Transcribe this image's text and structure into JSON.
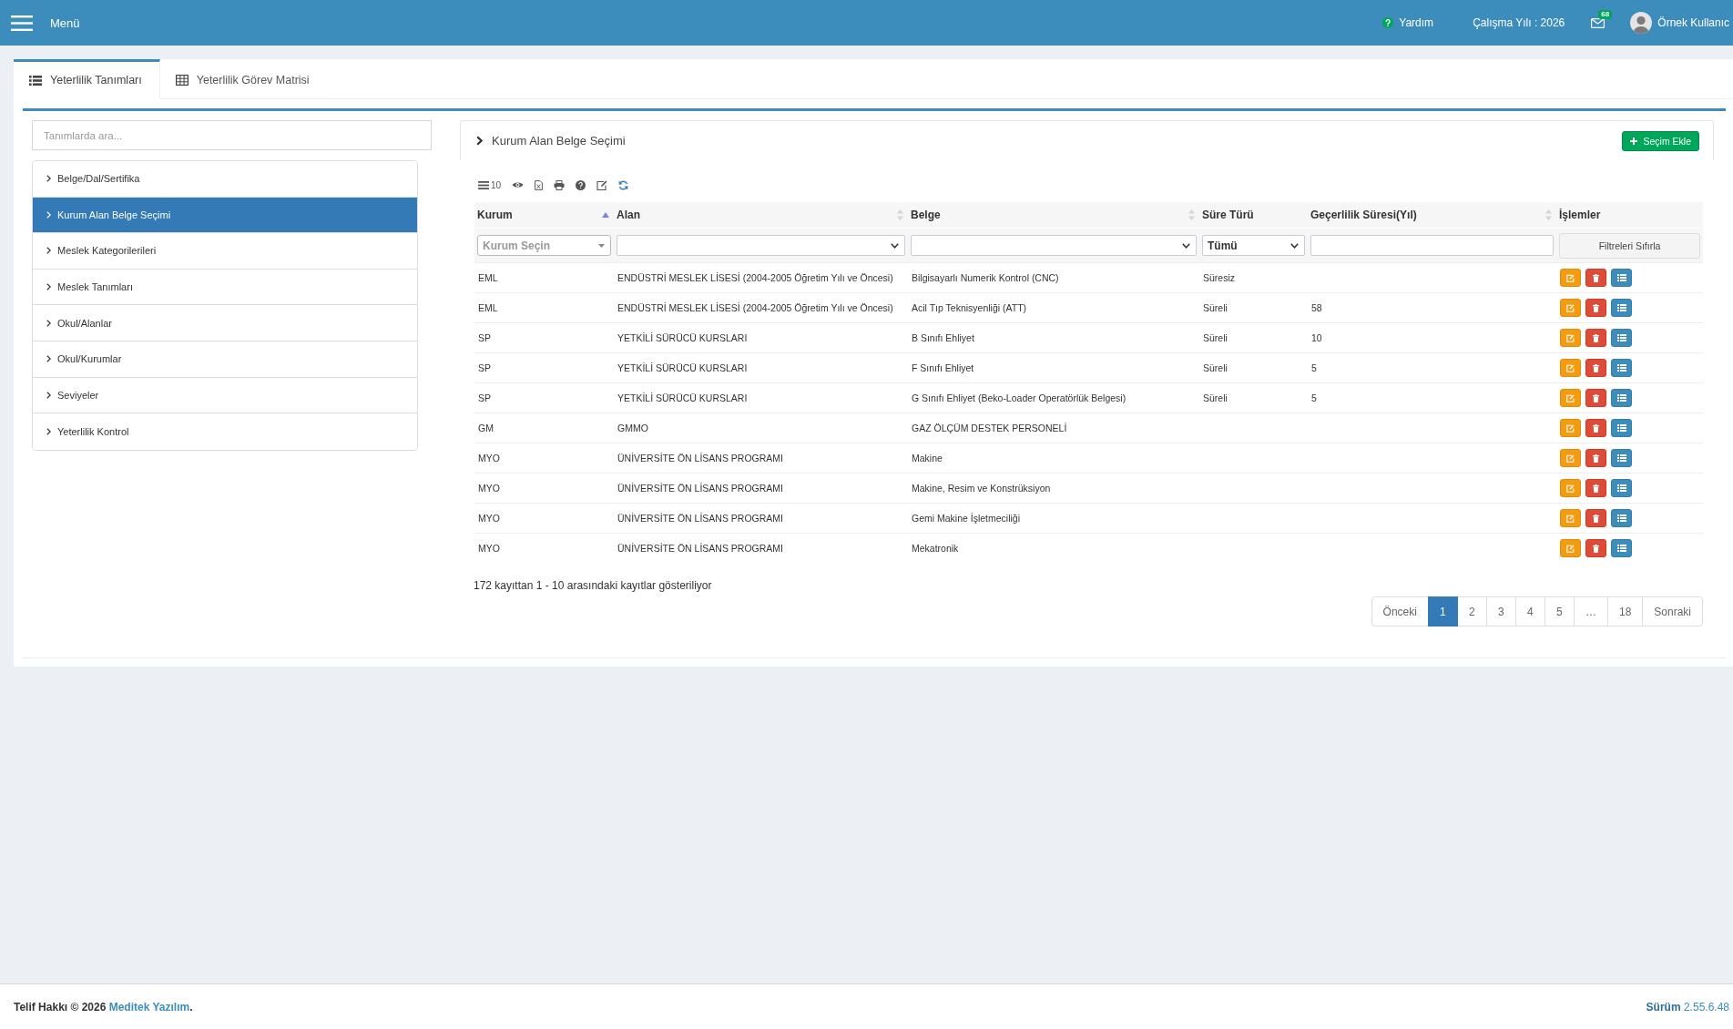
{
  "topbar": {
    "menu": "Menü",
    "help": "Yardım",
    "work_year": "Çalışma Yılı : 2026",
    "mail_count": "68",
    "user": "Örnek Kullanıc"
  },
  "tabs": [
    {
      "label": "Yeterlilik Tanımları",
      "kind": "list",
      "selected": true
    },
    {
      "label": "Yeterlilik Görev Matrisi",
      "kind": "table",
      "selected": false
    }
  ],
  "sidebar": {
    "search": {
      "placeholder": "Tanımlarda ara..."
    },
    "items": [
      {
        "label": "Belge/Dal/Sertifika",
        "selected": false
      },
      {
        "label": "Kurum Alan Belge Seçimi",
        "selected": true
      },
      {
        "label": "Meslek Kategorilerileri",
        "selected": false
      },
      {
        "label": "Meslek Tanımları",
        "selected": false
      },
      {
        "label": "Okul/Alanlar",
        "selected": false
      },
      {
        "label": "Okul/Kurumlar",
        "selected": false
      },
      {
        "label": "Seviyeler",
        "selected": false
      },
      {
        "label": "Yeterlilik Kontrol",
        "selected": false
      }
    ]
  },
  "panel": {
    "title": "Kurum Alan Belge Seçimi",
    "add_button": "Seçim Ekle",
    "toolbar": {
      "page_size": "10"
    },
    "table": {
      "columns": [
        {
          "label": "Kurum",
          "sortable": true,
          "sorted": true
        },
        {
          "label": "Alan",
          "sortable": true,
          "sorted": false
        },
        {
          "label": "Belge",
          "sortable": true,
          "sorted": false
        },
        {
          "label": "Süre Türü",
          "sortable": false,
          "sorted": false
        },
        {
          "label": "Geçerlilik Süresi(Yıl)",
          "sortable": true,
          "sorted": false
        },
        {
          "label": "İşlemler",
          "sortable": false,
          "sorted": false
        }
      ],
      "filters": [
        {
          "kind": "combo",
          "placeholder": "Kurum Seçin"
        },
        {
          "kind": "select"
        },
        {
          "kind": "select"
        },
        {
          "kind": "select",
          "value": "Tümü"
        },
        {
          "kind": "text"
        },
        {
          "kind": "button",
          "label": "Filtreleri Sıfırla"
        }
      ],
      "rows": [
        {
          "kurum": "EML",
          "alan": "ENDÜSTRİ MESLEK LİSESİ (2004-2005 Öğretim Yılı ve Öncesi)",
          "belge": "Bilgisayarlı Numerik Kontrol (CNC)",
          "sure_turu": "Süresiz"
        },
        {
          "kurum": "EML",
          "alan": "ENDÜSTRİ MESLEK LİSESİ (2004-2005 Öğretim Yılı ve Öncesi)",
          "belge": "Acil Tıp Teknisyenliği (ATT)",
          "sure_turu": "Süreli",
          "gecerlilik": "58"
        },
        {
          "kurum": "SP",
          "alan": "YETKİLİ SÜRÜCÜ KURSLARI",
          "belge": "B Sınıfı Ehliyet",
          "sure_turu": "Süreli",
          "gecerlilik": "10"
        },
        {
          "kurum": "SP",
          "alan": "YETKİLİ SÜRÜCÜ KURSLARI",
          "belge": "F Sınıfı Ehliyet",
          "sure_turu": "Süreli",
          "gecerlilik": "5"
        },
        {
          "kurum": "SP",
          "alan": "YETKİLİ SÜRÜCÜ KURSLARI",
          "belge": "G Sınıfı Ehliyet (Beko-Loader Operatörlük Belgesi)",
          "sure_turu": "Süreli",
          "gecerlilik": "5"
        },
        {
          "kurum": "GM",
          "alan": "GMMO",
          "belge": "GAZ ÖLÇÜM DESTEK PERSONELİ"
        },
        {
          "kurum": "MYO",
          "alan": "ÜNİVERSİTE ÖN LİSANS PROGRAMI",
          "belge": "Makine"
        },
        {
          "kurum": "MYO",
          "alan": "ÜNİVERSİTE ÖN LİSANS PROGRAMI",
          "belge": "Makine, Resim ve Konstrüksiyon"
        },
        {
          "kurum": "MYO",
          "alan": "ÜNİVERSİTE ÖN LİSANS PROGRAMI",
          "belge": "Gemi Makine İşletmeciliği"
        },
        {
          "kurum": "MYO",
          "alan": "ÜNİVERSİTE ÖN LİSANS PROGRAMI",
          "belge": "Mekatronik"
        }
      ]
    },
    "info": "172 kayıttan 1 - 10 arasındaki kayıtlar gösteriliyor",
    "pagination": {
      "previous": "Önceki",
      "pages": [
        {
          "label": "1",
          "selected": true
        },
        {
          "label": "2",
          "selected": false
        },
        {
          "label": "3",
          "selected": false
        },
        {
          "label": "4",
          "selected": false
        },
        {
          "label": "5",
          "selected": false
        },
        {
          "label": "…",
          "selected": false
        },
        {
          "label": "18",
          "selected": false
        }
      ],
      "next": "Sonraki"
    }
  },
  "footer": {
    "copyright": "Telif Hakkı © 2026",
    "company": "Meditek Yazılım",
    "suffix": ".",
    "version": "**Sürüm** 2.55.6.48"
  }
}
